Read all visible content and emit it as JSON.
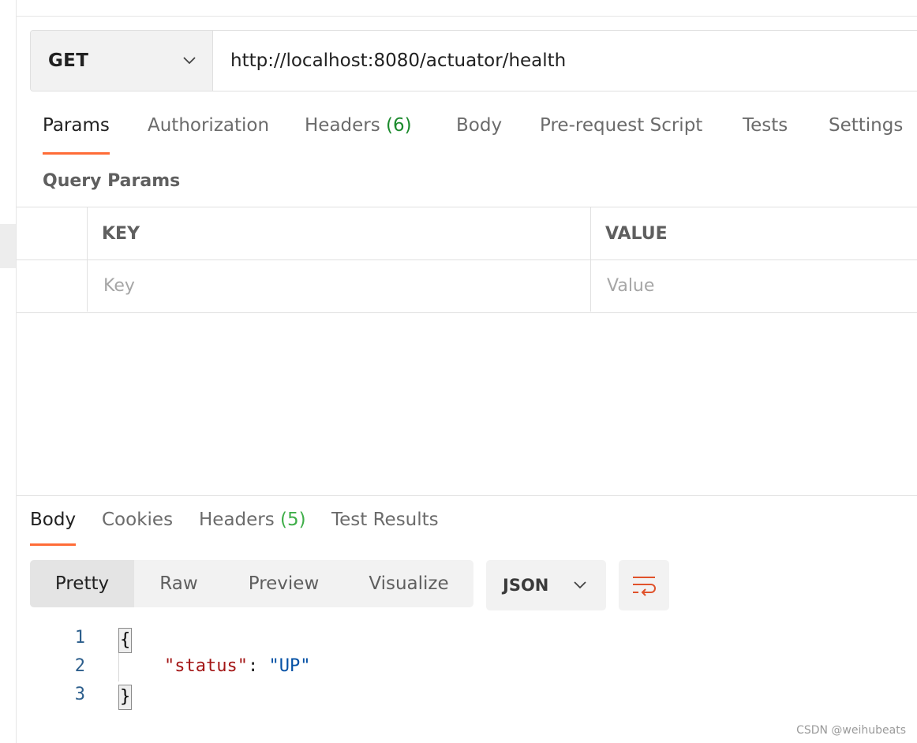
{
  "request": {
    "method": "GET",
    "url": "http://localhost:8080/actuator/health"
  },
  "request_tabs": [
    {
      "label": "Params",
      "count": ""
    },
    {
      "label": "Authorization",
      "count": ""
    },
    {
      "label": "Headers",
      "count": "(6)"
    },
    {
      "label": "Body",
      "count": ""
    },
    {
      "label": "Pre-request Script",
      "count": ""
    },
    {
      "label": "Tests",
      "count": ""
    },
    {
      "label": "Settings",
      "count": ""
    }
  ],
  "query_params": {
    "title": "Query Params",
    "columns": {
      "key": "KEY",
      "value": "VALUE"
    },
    "placeholders": {
      "key": "Key",
      "value": "Value"
    }
  },
  "response_tabs": [
    {
      "label": "Body",
      "count": ""
    },
    {
      "label": "Cookies",
      "count": ""
    },
    {
      "label": "Headers",
      "count": "(5)"
    },
    {
      "label": "Test Results",
      "count": ""
    }
  ],
  "view_modes": [
    "Pretty",
    "Raw",
    "Preview",
    "Visualize"
  ],
  "format": "JSON",
  "code": {
    "line_numbers": [
      "1",
      "2",
      "3"
    ],
    "open_brace": "{",
    "key": "\"status\"",
    "colon": ": ",
    "value": "\"UP\"",
    "close_brace": "}"
  },
  "watermark": "CSDN @weihubeats",
  "colors": {
    "accent": "#ff6c37",
    "count_green": "#1b8a2c",
    "json_key": "#a31515",
    "json_string": "#0451a5"
  },
  "icons": {
    "method_chevron": "chevron-down-icon",
    "format_chevron": "chevron-down-icon",
    "wrap": "wrap-lines-icon"
  }
}
